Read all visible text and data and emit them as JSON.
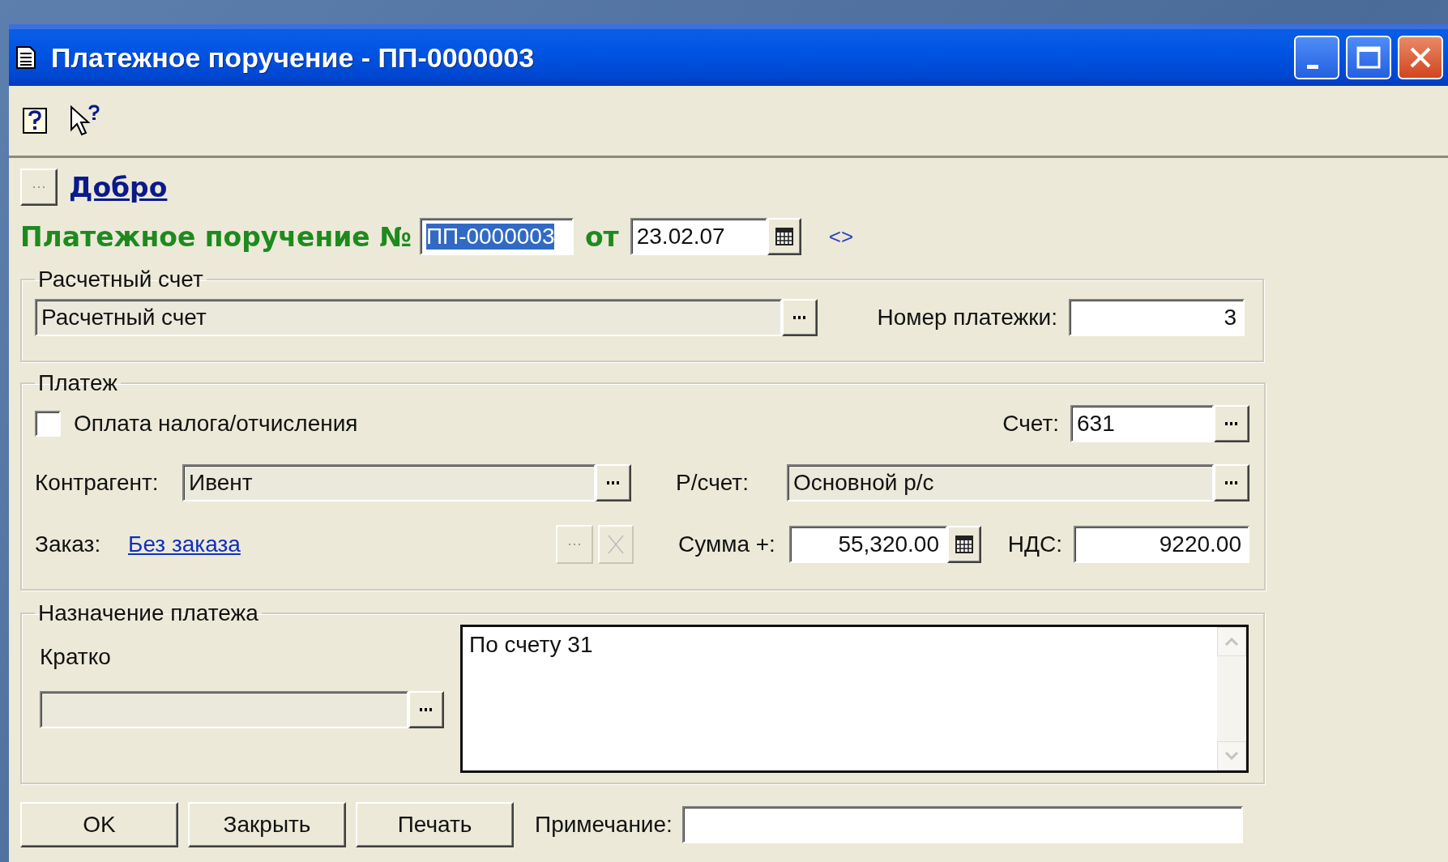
{
  "window": {
    "title": "Платежное поручение - ПП-0000003"
  },
  "link": {
    "text": "Добро"
  },
  "header": {
    "title": "Платежное поручение №",
    "number": "ПП-0000003",
    "number_selected": true,
    "date_label": "от",
    "date": "23.02.07",
    "nav": "<>"
  },
  "account_group": {
    "legend": "Расчетный счет",
    "account": "Расчетный счет",
    "number_label": "Номер платежки:",
    "number": "3"
  },
  "payment_group": {
    "legend": "Платеж",
    "tax_payment": {
      "label": "Оплата налога/отчисления",
      "checked": false
    },
    "account_label": "Счет:",
    "account": "631",
    "counterparty_label": "Контрагент:",
    "counterparty": "Ивент",
    "bank_account_label": "Р/счет:",
    "bank_account": "Основной р/с",
    "order_label": "Заказ:",
    "order": "Без заказа",
    "sum_label": "Сумма +:",
    "sum": "55,320.00",
    "vat_label": "НДС:",
    "vat": "9220.00"
  },
  "purpose_group": {
    "legend": "Назначение платежа",
    "short_label": "Кратко",
    "text": "По счету 31"
  },
  "buttons": [
    {
      "label": "OK"
    },
    {
      "label": "Закрыть"
    },
    {
      "label": "Печать"
    }
  ],
  "note_label": "Примечание:"
}
